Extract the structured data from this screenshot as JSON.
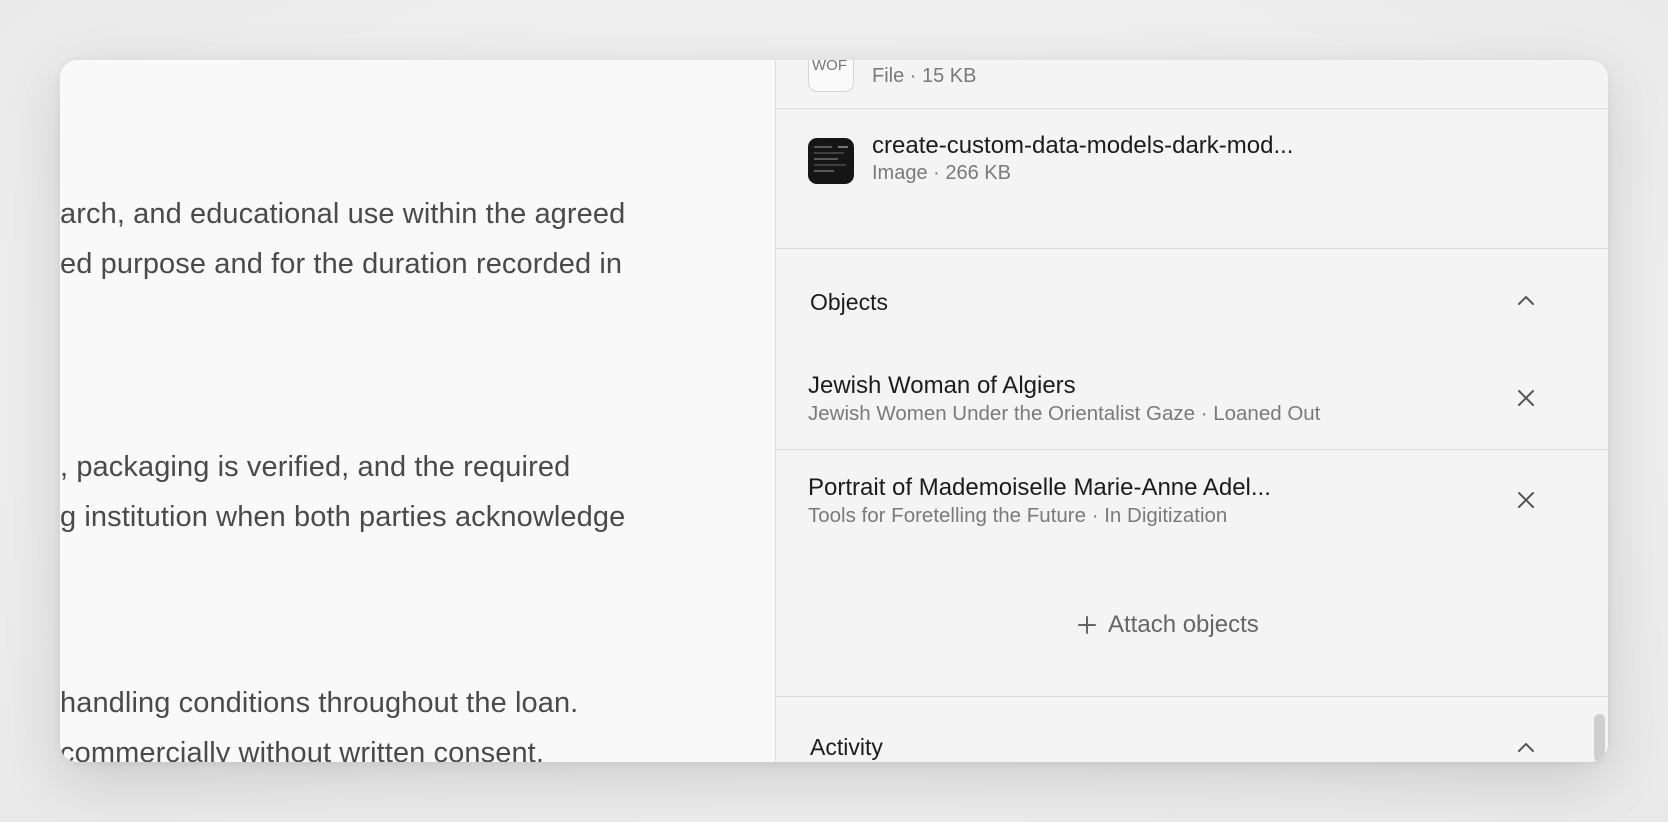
{
  "document": {
    "lines": [
      "arch, and educational use within the agreed",
      "ed purpose and for the duration recorded in",
      ", packaging is verified, and the required",
      "g institution when both parties acknowledge",
      "handling conditions throughout the loan.",
      " commercially without written consent."
    ]
  },
  "files": [
    {
      "thumb_text": "WOF",
      "meta": "File · 15 KB"
    },
    {
      "name": "create-custom-data-models-dark-mod...",
      "meta": "Image · 266 KB"
    }
  ],
  "objects_section": {
    "title": "Objects",
    "items": [
      {
        "title": "Jewish Woman of Algiers",
        "subtitle": "Jewish Women Under the Orientalist Gaze · Loaned Out"
      },
      {
        "title": "Portrait of Mademoiselle Marie-Anne Adel...",
        "subtitle": "Tools for Foretelling the Future · In Digitization"
      }
    ],
    "attach_label": "Attach objects"
  },
  "activity_section": {
    "title": "Activity"
  },
  "icons": {
    "collapse": "chevron-up-icon",
    "remove": "close-icon",
    "attach": "plus-icon"
  },
  "colors": {
    "panel_background": "#f4f4f4",
    "document_background": "#f9f9f9",
    "text_primary": "#1c1c1c",
    "text_secondary": "#7a7a7a"
  }
}
